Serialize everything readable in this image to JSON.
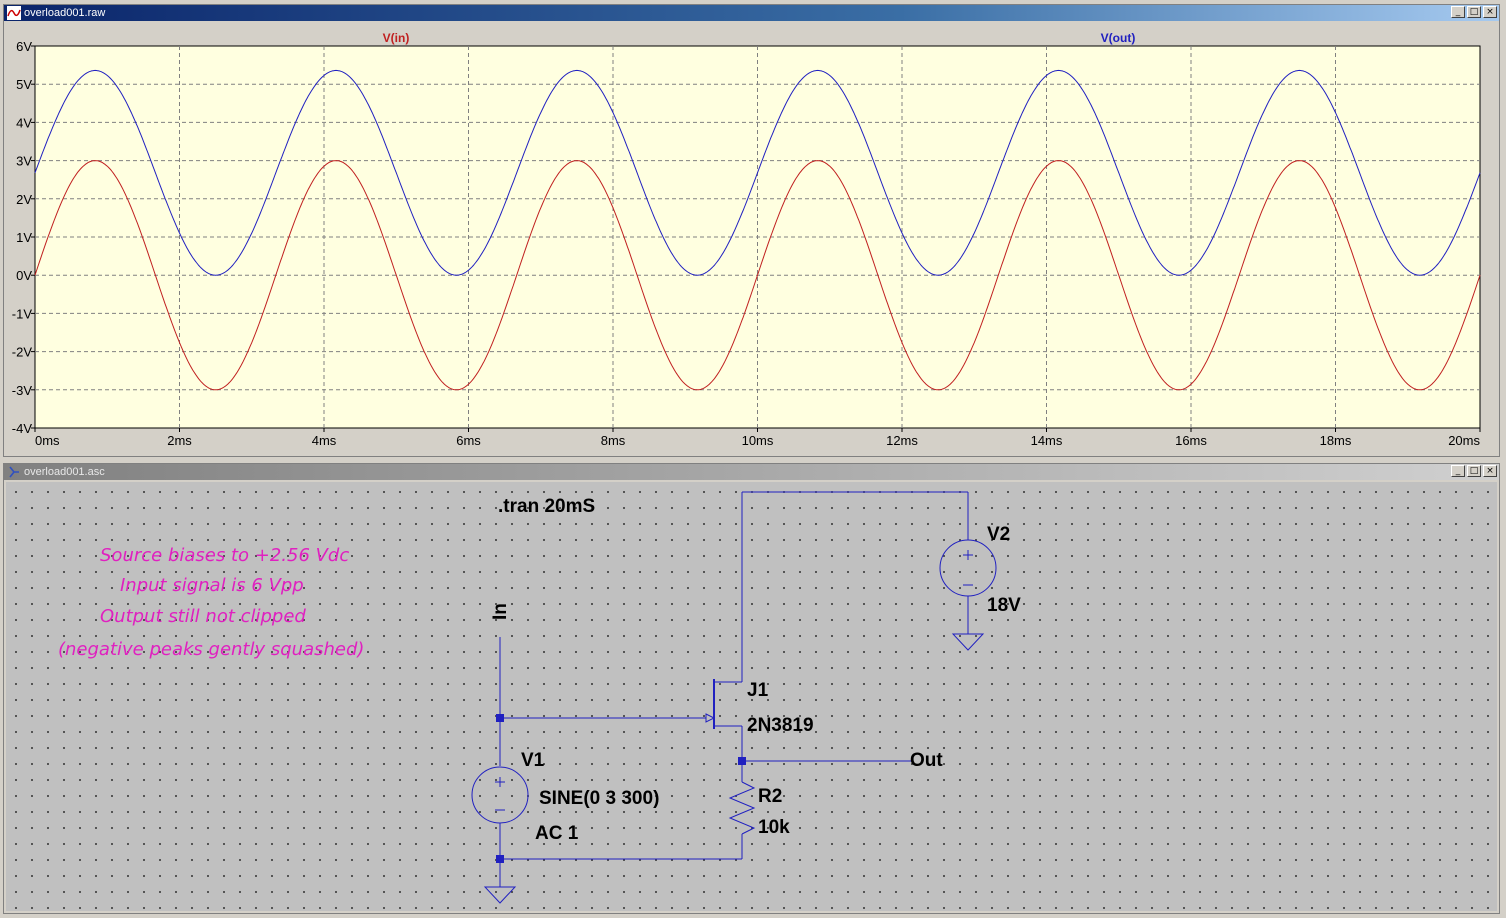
{
  "waveform_window": {
    "title": "overload001.raw",
    "buttons": [
      "_",
      "□",
      "×"
    ]
  },
  "schematic_window": {
    "title": "overload001.asc",
    "buttons": [
      "_",
      "□",
      "×"
    ]
  },
  "chart_data": {
    "type": "line",
    "x": {
      "label": "",
      "range": [
        0,
        20
      ],
      "unit": "ms",
      "ticks": [
        "0ms",
        "2ms",
        "4ms",
        "6ms",
        "8ms",
        "10ms",
        "12ms",
        "14ms",
        "16ms",
        "18ms",
        "20ms"
      ]
    },
    "y": {
      "label": "",
      "range": [
        -4,
        6
      ],
      "unit": "V",
      "ticks": [
        "6V",
        "5V",
        "4V",
        "3V",
        "2V",
        "1V",
        "0V",
        "-1V",
        "-2V",
        "-3V",
        "-4V"
      ]
    },
    "grid": true,
    "series": [
      {
        "name": "V(in)",
        "color": "#c02020",
        "function": "3*sin(2*pi*300*t)",
        "offset": 0,
        "amplitude": 3,
        "frequency_hz": 300
      },
      {
        "name": "V(out)",
        "color": "#2020c0",
        "function": "2.68+2.68*sin(2*pi*300*t)",
        "offset": 2.68,
        "amplitude": 2.68,
        "frequency_hz": 300
      }
    ]
  },
  "schematic": {
    "directive": ".tran 20mS",
    "comments": [
      "Source biases to +2.56 Vdc",
      "Input signal is 6 Vpp",
      "Output still not clipped",
      "(negative peaks gently squashed)"
    ],
    "net_in": "In",
    "net_out": "Out",
    "v1_name": "V1",
    "v1_value": "SINE(0 3 300)",
    "v1_ac": "AC 1",
    "v2_name": "V2",
    "v2_value": "18V",
    "j1_name": "J1",
    "j1_model": "2N3819",
    "r2_name": "R2",
    "r2_value": "10k"
  }
}
